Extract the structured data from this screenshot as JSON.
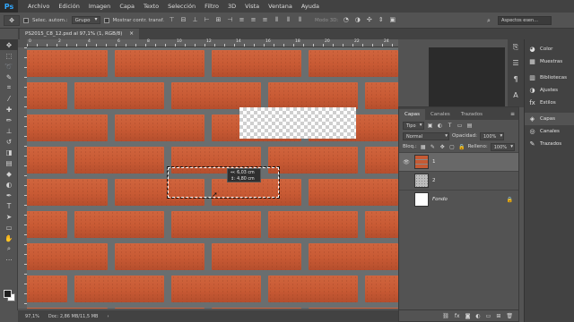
{
  "app": {
    "logo": "Ps"
  },
  "menu": [
    "Archivo",
    "Edición",
    "Imagen",
    "Capa",
    "Texto",
    "Selección",
    "Filtro",
    "3D",
    "Vista",
    "Ventana",
    "Ayuda"
  ],
  "options_bar": {
    "auto_select_label": "Selec. autom.:",
    "auto_select_value": "Grupo",
    "show_transform_label": "Mostrar contr. transf.",
    "mode3d_label": "Modo 3D:",
    "workspace": "Aspectos esen..."
  },
  "document": {
    "tab_title": "PS2015_C8_12.psd al 97,1% (1, RGB/8)",
    "close_glyph": "×",
    "ruler_numbers": [
      "0",
      "2",
      "4",
      "6",
      "8",
      "10",
      "12",
      "14",
      "16",
      "18",
      "20",
      "22",
      "24"
    ],
    "tooltip": {
      "width": "↔: 6,03 cm",
      "height": "↕: 4,80 cm"
    }
  },
  "status_bar": {
    "zoom": "97,1%",
    "doc_size": "Doc: 2,86 MB/11,5 MB"
  },
  "layers_panel": {
    "tabs": [
      "Capas",
      "Canales",
      "Trazados"
    ],
    "filter_kind": "Tipo",
    "blend_mode": "Normal",
    "opacity_label": "Opacidad:",
    "opacity_value": "100%",
    "lock_label": "Bloq.:",
    "fill_label": "Relleno:",
    "fill_value": "100%",
    "layers": [
      {
        "name": "1",
        "visible": true,
        "selected": true,
        "thumb": "brick"
      },
      {
        "name": "2",
        "visible": false,
        "selected": false,
        "thumb": "noise"
      },
      {
        "name": "Fondo",
        "visible": false,
        "selected": false,
        "thumb": "white",
        "locked": true
      }
    ]
  },
  "side_panels": {
    "group1": [
      "Color",
      "Muestras"
    ],
    "group2": [
      "Bibliotecas",
      "Ajustes",
      "Estilos"
    ],
    "group3": [
      "Capas",
      "Canales",
      "Trazados"
    ]
  },
  "colors": {
    "accent": "#31a8ff",
    "brick": "#c85a34",
    "mortar": "#6a6e6f"
  }
}
